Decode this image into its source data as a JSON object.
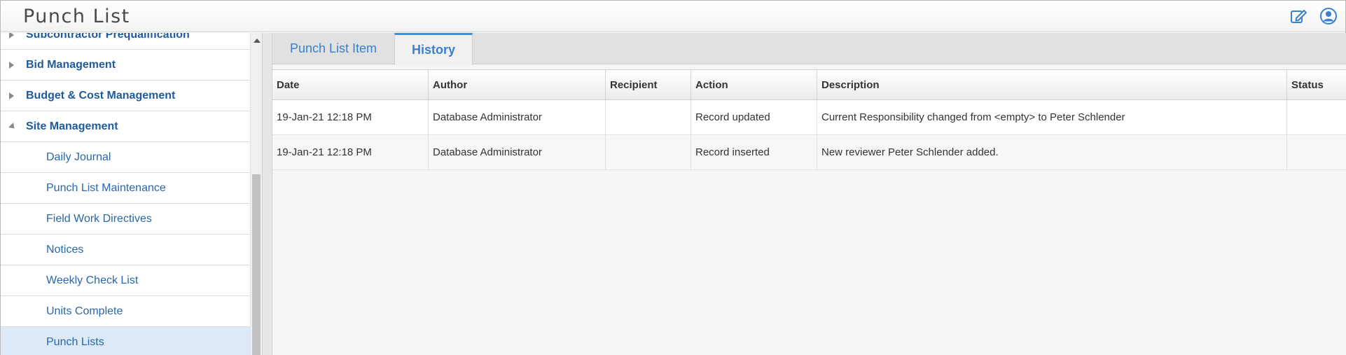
{
  "header": {
    "title": "Punch List",
    "edit_icon": "edit-icon",
    "user_icon": "user-icon"
  },
  "sidebar": {
    "items": [
      {
        "label": "Subcontractor Prequalification",
        "kind": "category",
        "expanded": false
      },
      {
        "label": "Bid Management",
        "kind": "category",
        "expanded": false
      },
      {
        "label": "Budget & Cost Management",
        "kind": "category",
        "expanded": false
      },
      {
        "label": "Site Management",
        "kind": "category",
        "expanded": true
      },
      {
        "label": "Daily Journal",
        "kind": "sub"
      },
      {
        "label": "Punch List Maintenance",
        "kind": "sub"
      },
      {
        "label": "Field Work Directives",
        "kind": "sub"
      },
      {
        "label": "Notices",
        "kind": "sub"
      },
      {
        "label": "Weekly Check List",
        "kind": "sub"
      },
      {
        "label": "Units Complete",
        "kind": "sub"
      },
      {
        "label": "Punch Lists",
        "kind": "sub",
        "selected": true
      }
    ]
  },
  "tabs": [
    {
      "label": "Punch List Item",
      "active": false
    },
    {
      "label": "History",
      "active": true
    }
  ],
  "grid": {
    "columns": [
      "Date",
      "Author",
      "Recipient",
      "Action",
      "Description",
      "Status"
    ],
    "rows": [
      [
        "19-Jan-21 12:18 PM",
        "Database Administrator",
        "",
        "Record updated",
        "Current Responsibility changed from <empty> to Peter Schlender",
        ""
      ],
      [
        "19-Jan-21 12:18 PM",
        "Database Administrator",
        "",
        "Record inserted",
        "New reviewer Peter Schlender added.",
        ""
      ]
    ]
  },
  "colors": {
    "accent": "#3a7fd0",
    "nav_text": "#1f5b9c",
    "selected_bg": "#dce9f6"
  }
}
